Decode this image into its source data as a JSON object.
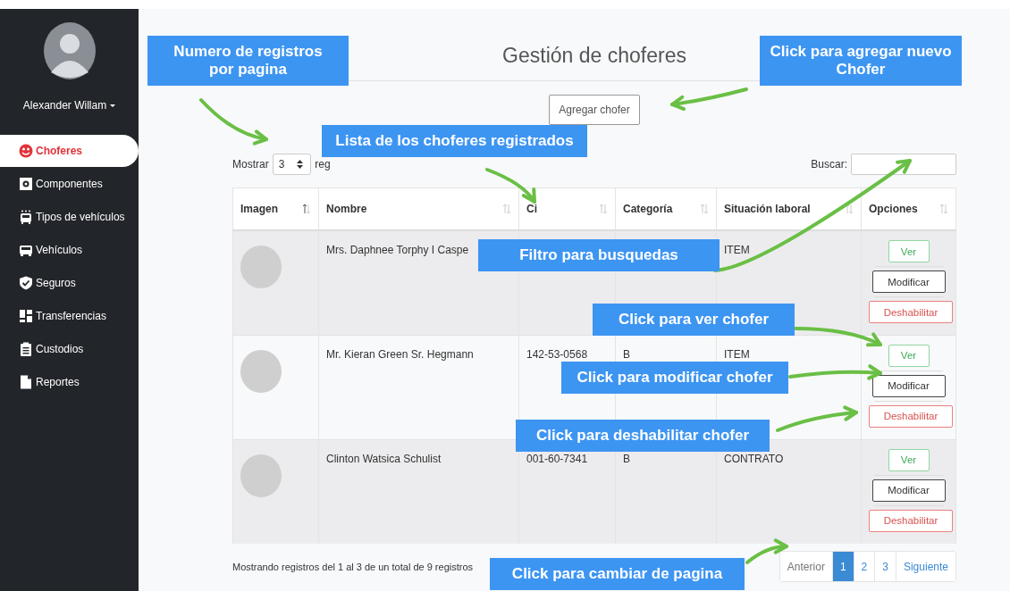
{
  "sidebar": {
    "user_name": "Alexander Willam",
    "items": [
      {
        "label": "Choferes",
        "selected": true
      },
      {
        "label": "Componentes",
        "selected": false
      },
      {
        "label": "Tipos de vehículos",
        "selected": false
      },
      {
        "label": "Vehículos",
        "selected": false
      },
      {
        "label": "Seguros",
        "selected": false
      },
      {
        "label": "Transferencias",
        "selected": false
      },
      {
        "label": "Custodios",
        "selected": false
      },
      {
        "label": "Reportes",
        "selected": false
      }
    ]
  },
  "title": "Gestión de choferes",
  "add_button": "Agregar chofer",
  "length_menu": {
    "label": "Mostrar",
    "value": "3",
    "suffix": "reg"
  },
  "search": {
    "label": "Buscar:"
  },
  "table": {
    "columns": [
      {
        "label": "Imagen",
        "sorted": true
      },
      {
        "label": "Nombre",
        "sorted": false
      },
      {
        "label": "Ci",
        "sorted": false
      },
      {
        "label": "Categoría",
        "sorted": false
      },
      {
        "label": "Situación laboral",
        "sorted": false
      },
      {
        "label": "Opciones",
        "sorted": false
      }
    ],
    "rows": [
      {
        "nombre": "Mrs. Daphnee Torphy I Caspe",
        "situacion": "ITEM",
        "actions": [
          {
            "label": "Ver",
            "kind": "view"
          },
          {
            "label": "Modificar",
            "kind": "edit"
          },
          {
            "label": "Deshabilitar",
            "kind": "disable"
          }
        ]
      },
      {
        "nombre": "Mr. Kieran Green Sr. Hegmann",
        "ci": "142-53-0568",
        "categoria": "B",
        "situacion": "ITEM",
        "actions": [
          {
            "label": "Ver",
            "kind": "view"
          },
          {
            "label": "Modificar",
            "kind": "edit"
          },
          {
            "label": "Deshabilitar",
            "kind": "disable"
          }
        ]
      },
      {
        "nombre": "Clinton Watsica Schulist",
        "ci": "001-60-7341",
        "categoria": "B",
        "situacion": "CONTRATO",
        "actions": [
          {
            "label": "Ver",
            "kind": "view"
          },
          {
            "label": "Modificar",
            "kind": "edit"
          },
          {
            "label": "Deshabilitar",
            "kind": "disable"
          }
        ]
      }
    ]
  },
  "info": "Mostrando registros del 1 al 3 de un total de 9 registros",
  "pagination": {
    "previous": "Anterior",
    "pages": [
      {
        "label": "1",
        "selected": true
      },
      {
        "label": "2",
        "selected": false
      },
      {
        "label": "3",
        "selected": false
      }
    ],
    "next": "Siguiente"
  },
  "annotations": [
    "Numero de registros por pagina",
    "Click para agregar nuevo Chofer",
    "Lista de los choferes registrados",
    "Filtro para busquedas",
    "Click para ver chofer",
    "Click para modificar chofer",
    "Click para deshabilitar chofer",
    "Click para cambiar de pagina"
  ]
}
